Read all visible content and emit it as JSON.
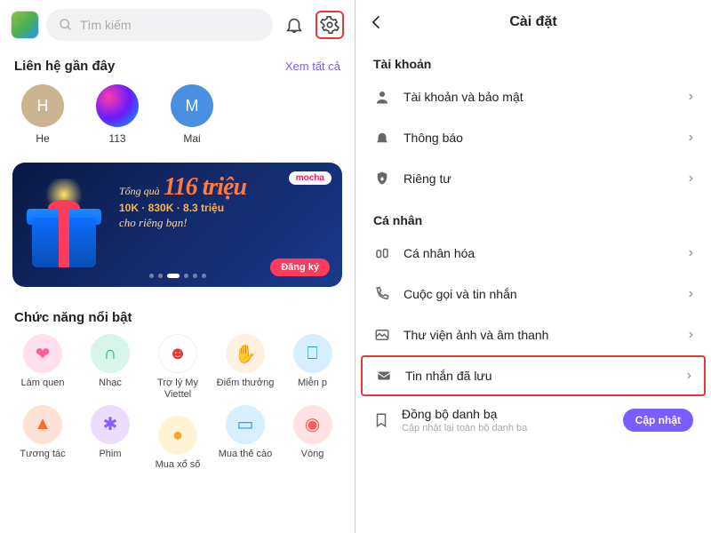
{
  "left": {
    "search_placeholder": "Tìm kiếm",
    "recent_title": "Liên hệ gần đây",
    "see_all": "Xem tất cả",
    "contacts": [
      {
        "label": "H",
        "name": "He",
        "bg": "#c9b590"
      },
      {
        "label": "",
        "name": "113",
        "bg": ""
      },
      {
        "label": "M",
        "name": "Mai",
        "bg": "#4a90e2"
      }
    ],
    "banner": {
      "tag": "mocha",
      "line1": "Tổng quà",
      "big": "116 triệu",
      "line2": "10K · 830K · 8.3 triệu",
      "line3": "cho riêng bạn!",
      "cta": "Đăng ký"
    },
    "features_title": "Chức năng nổi bật",
    "features": [
      [
        {
          "label": "Làm quen",
          "icon": "heart",
          "bg": "#ffe0ec",
          "fg": "#ff5c9b"
        },
        {
          "label": "Tương tác",
          "icon": "flame",
          "bg": "#ffe2d6",
          "fg": "#ff6a2b"
        }
      ],
      [
        {
          "label": "Nhạc",
          "icon": "headphone",
          "bg": "#d8f5ea",
          "fg": "#1fb47a"
        },
        {
          "label": "Phim",
          "icon": "reel",
          "bg": "#ecdcff",
          "fg": "#8a5cff"
        }
      ],
      [
        {
          "label": "Trợ lý My Viettel",
          "icon": "bot",
          "bg": "#ffffff",
          "fg": "#e53935"
        },
        {
          "label": "Mua xổ số",
          "icon": "ball",
          "bg": "#fff3d6",
          "fg": "#f5a623"
        }
      ],
      [
        {
          "label": "Điểm thưởng",
          "icon": "hand",
          "bg": "#fff0e0",
          "fg": "#f5a623"
        },
        {
          "label": "Mua thẻ cào",
          "icon": "card",
          "bg": "#d6f0ff",
          "fg": "#2196f3"
        }
      ],
      [
        {
          "label": "Miễn p",
          "icon": "gift",
          "bg": "#d6f0ff",
          "fg": "#2196f3"
        },
        {
          "label": "Vòng",
          "icon": "wheel",
          "bg": "#ffe2e2",
          "fg": "#ff5c5c"
        }
      ]
    ]
  },
  "right": {
    "title": "Cài đặt",
    "groups": [
      {
        "label": "Tài khoản",
        "items": [
          {
            "icon": "user",
            "label": "Tài khoản và bảo mật"
          },
          {
            "icon": "bell",
            "label": "Thông báo"
          },
          {
            "icon": "lock",
            "label": "Riêng tư"
          }
        ]
      },
      {
        "label": "Cá nhân",
        "items": [
          {
            "icon": "palette",
            "label": "Cá nhân hóa"
          },
          {
            "icon": "phone",
            "label": "Cuộc gọi và tin nhắn"
          },
          {
            "icon": "image",
            "label": "Thư viện ảnh và âm thanh"
          },
          {
            "icon": "mail",
            "label": "Tin nhắn đã lưu",
            "highlight": true
          }
        ]
      }
    ],
    "sync": {
      "title": "Đồng bộ danh bạ",
      "sub": "Cập nhật lại toàn bộ danh bạ",
      "btn": "Cập nhật"
    }
  }
}
